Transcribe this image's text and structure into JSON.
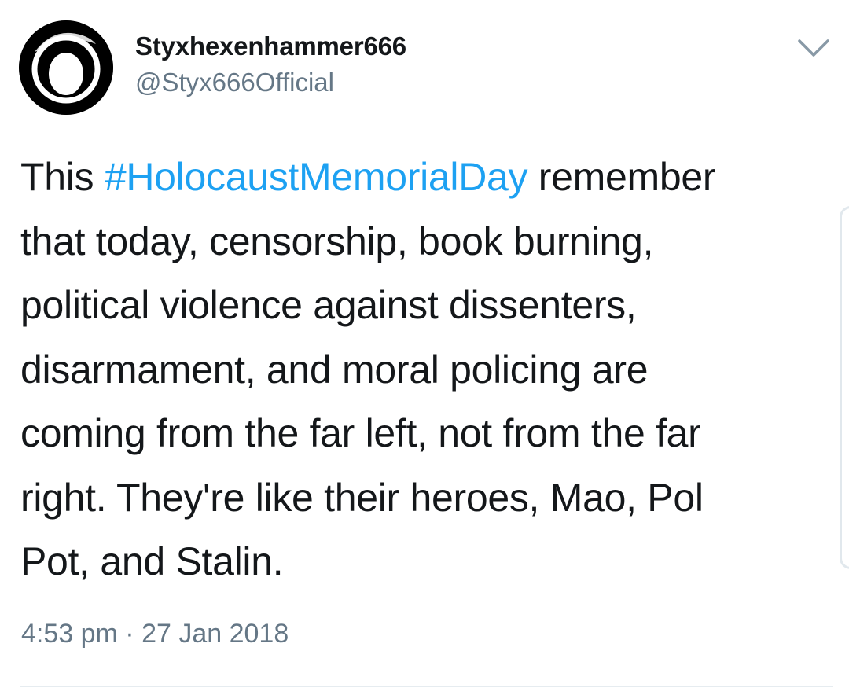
{
  "tweet": {
    "display_name": "Styxhexenhammer666",
    "handle": "@Styx666Official",
    "text_lines": [
      {
        "pre": "This ",
        "hashtag": "#HolocaustMemorialDay",
        "post": " remember"
      },
      {
        "pre": "that today, censorship, book burning,"
      },
      {
        "pre": "political violence against dissenters,"
      },
      {
        "pre": "disarmament, and moral policing are"
      },
      {
        "pre": "coming from the far left, not from the far"
      },
      {
        "pre": "right. They're like their heroes, Mao, Pol"
      },
      {
        "pre": "Pot, and Stalin."
      }
    ],
    "timestamp": "4:53 pm · 27 Jan 2018"
  },
  "icons": {
    "avatar": "circle-logo-icon",
    "menu": "chevron-down-icon"
  },
  "colors": {
    "text": "#14171a",
    "secondary": "#657786",
    "hashtag": "#1da1f2",
    "divider": "#e6ecf0"
  }
}
